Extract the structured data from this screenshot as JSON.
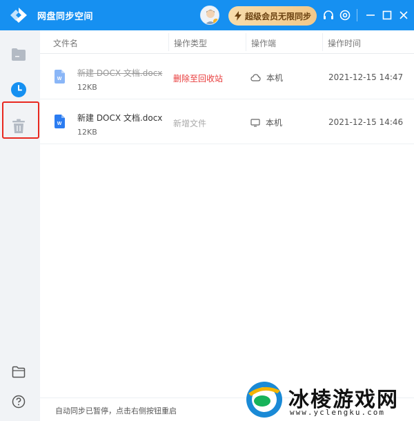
{
  "app": {
    "title": "网盘同步空间"
  },
  "titlebar": {
    "vip_label": "超级会员无限同步"
  },
  "table": {
    "columns": [
      "文件名",
      "操作类型",
      "操作端",
      "操作时间"
    ],
    "rows": [
      {
        "name": "新建 DOCX 文档.docx",
        "size": "12KB",
        "op_type": "删除至回收站",
        "device": "本机",
        "device_icon": "cloud-icon",
        "time": "2021-12-15 14:47",
        "status": "deleted"
      },
      {
        "name": "新建 DOCX 文档.docx",
        "size": "12KB",
        "op_type": "新增文件",
        "device": "本机",
        "device_icon": "monitor-icon",
        "time": "2021-12-15 14:46",
        "status": "added"
      }
    ]
  },
  "footer": {
    "status_text": "自动同步已暂停，点击右侧按钮重启"
  },
  "watermark": {
    "title": "冰棱游戏网",
    "url": "www.yclengku.com"
  },
  "colors": {
    "accent": "#1690f1",
    "delete": "#e83a3a",
    "highlight_box": "#e8271f"
  }
}
